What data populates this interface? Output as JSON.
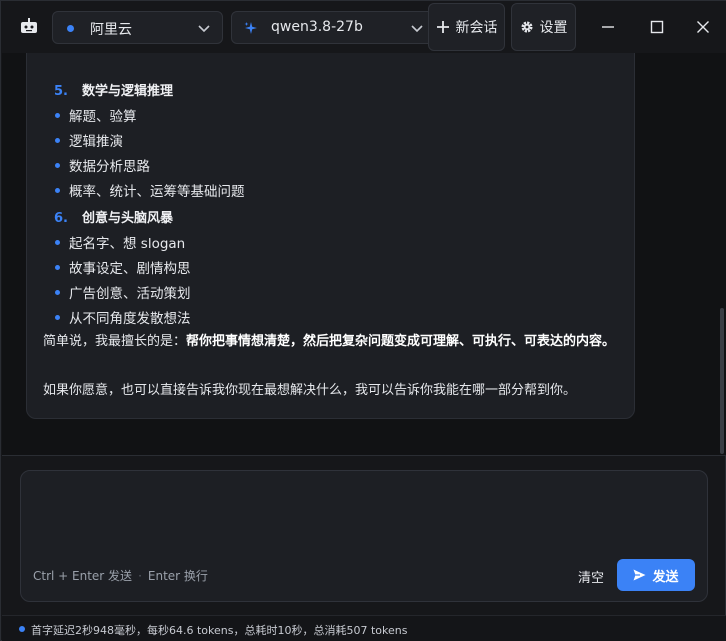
{
  "titlebar": {
    "provider": "阿里云",
    "model": "qwen3.8-27b",
    "new_chat_label": "新会话",
    "settings_label": "设置",
    "icons": {
      "app": "robot-icon",
      "new_chat": "plus-icon",
      "settings": "gear-icon",
      "minimize": "minimize-icon",
      "maximize": "maximize-icon",
      "close": "close-icon"
    }
  },
  "message": {
    "sections": [
      {
        "number": "5.",
        "title": "数学与逻辑推理",
        "items": [
          "解题、验算",
          "逻辑推演",
          "数据分析思路",
          "概率、统计、运筹等基础问题"
        ]
      },
      {
        "number": "6.",
        "title": "创意与头脑风暴",
        "items": [
          "起名字、想 slogan",
          "故事设定、剧情构思",
          "广告创意、活动策划",
          "从不同角度发散想法"
        ]
      }
    ],
    "summary_prefix": "简单说，我最擅长的是：",
    "summary_bold": "帮你把事情想清楚，然后把复杂问题变成可理解、可执行、可表达的内容。",
    "closing": "如果你愿意，也可以直接告诉我你现在最想解决什么，我可以告诉你我能在哪一部分帮到你。"
  },
  "composer": {
    "input_value": "",
    "hint_send": "Ctrl + Enter 发送",
    "hint_newline": "Enter 换行",
    "clear_label": "清空",
    "send_label": "发送"
  },
  "status": {
    "text": "首字延迟2秒948毫秒，每秒64.6 tokens，总耗时10秒，总消耗507 tokens"
  },
  "colors": {
    "accent": "#3b82f6",
    "background": "#151619",
    "bubble": "#1d1f24"
  }
}
